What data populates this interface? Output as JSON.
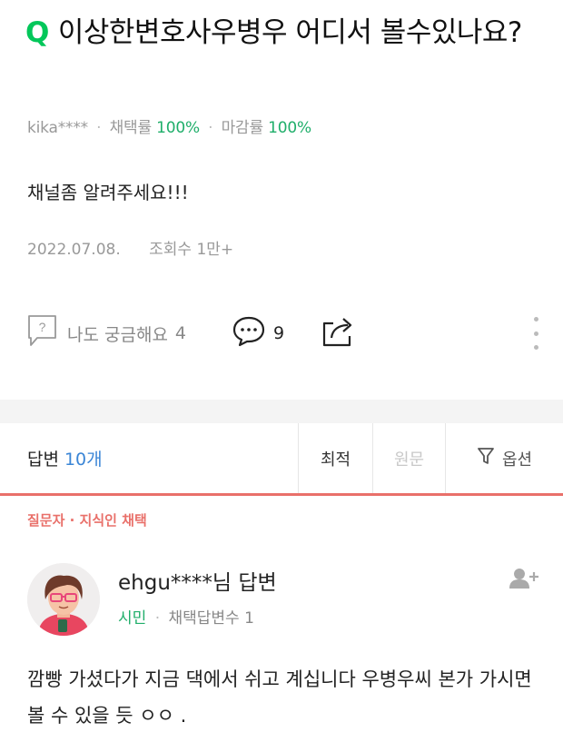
{
  "question": {
    "mark": "Q",
    "title": "이상한변호사우병우 어디서 볼수있나요?",
    "author": "kika****",
    "adopt_label": "채택률",
    "adopt_rate": "100%",
    "close_label": "마감률",
    "close_rate": "100%",
    "body": "채널좀 알려주세요!!!",
    "date": "2022.07.08.",
    "views": "조회수 1만+"
  },
  "actions": {
    "curious_label": "나도 궁금해요",
    "curious_count": "4",
    "comment_count": "9"
  },
  "answers_bar": {
    "label": "답변",
    "count": "10개",
    "sort_best": "최적",
    "sort_original": "원문",
    "options": "옵션"
  },
  "chosen_label": "질문자 · 지식인 채택",
  "answer": {
    "author_line": "ehgu****님 답변",
    "rank": "시민",
    "adopted_label": "채택답변수 1",
    "text": "깜빵 가셨다가 지금 댁에서 쉬고 계십니다 우병우씨 본가 가시면 볼 수 있을 듯 ㅇㅇ ."
  },
  "icons": {
    "curious": "question-bubble-icon",
    "comment": "speech-bubble-icon",
    "share": "share-icon",
    "more": "more-vertical-icon",
    "filter": "filter-icon",
    "follow": "add-friend-icon"
  },
  "colors": {
    "brand_green": "#03c75a",
    "accent_red": "#e9706a",
    "count_blue": "#3a85d6"
  }
}
